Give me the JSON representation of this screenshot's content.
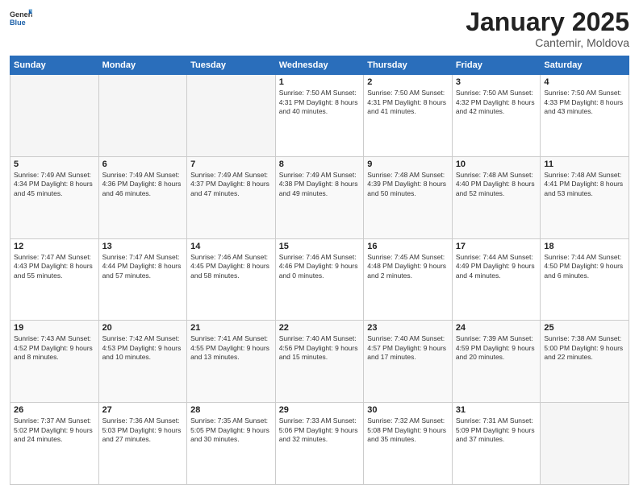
{
  "logo": {
    "text_general": "General",
    "text_blue": "Blue"
  },
  "header": {
    "title": "January 2025",
    "subtitle": "Cantemir, Moldova"
  },
  "days_of_week": [
    "Sunday",
    "Monday",
    "Tuesday",
    "Wednesday",
    "Thursday",
    "Friday",
    "Saturday"
  ],
  "weeks": [
    [
      {
        "day": "",
        "info": ""
      },
      {
        "day": "",
        "info": ""
      },
      {
        "day": "",
        "info": ""
      },
      {
        "day": "1",
        "info": "Sunrise: 7:50 AM\nSunset: 4:31 PM\nDaylight: 8 hours\nand 40 minutes."
      },
      {
        "day": "2",
        "info": "Sunrise: 7:50 AM\nSunset: 4:31 PM\nDaylight: 8 hours\nand 41 minutes."
      },
      {
        "day": "3",
        "info": "Sunrise: 7:50 AM\nSunset: 4:32 PM\nDaylight: 8 hours\nand 42 minutes."
      },
      {
        "day": "4",
        "info": "Sunrise: 7:50 AM\nSunset: 4:33 PM\nDaylight: 8 hours\nand 43 minutes."
      }
    ],
    [
      {
        "day": "5",
        "info": "Sunrise: 7:49 AM\nSunset: 4:34 PM\nDaylight: 8 hours\nand 45 minutes."
      },
      {
        "day": "6",
        "info": "Sunrise: 7:49 AM\nSunset: 4:36 PM\nDaylight: 8 hours\nand 46 minutes."
      },
      {
        "day": "7",
        "info": "Sunrise: 7:49 AM\nSunset: 4:37 PM\nDaylight: 8 hours\nand 47 minutes."
      },
      {
        "day": "8",
        "info": "Sunrise: 7:49 AM\nSunset: 4:38 PM\nDaylight: 8 hours\nand 49 minutes."
      },
      {
        "day": "9",
        "info": "Sunrise: 7:48 AM\nSunset: 4:39 PM\nDaylight: 8 hours\nand 50 minutes."
      },
      {
        "day": "10",
        "info": "Sunrise: 7:48 AM\nSunset: 4:40 PM\nDaylight: 8 hours\nand 52 minutes."
      },
      {
        "day": "11",
        "info": "Sunrise: 7:48 AM\nSunset: 4:41 PM\nDaylight: 8 hours\nand 53 minutes."
      }
    ],
    [
      {
        "day": "12",
        "info": "Sunrise: 7:47 AM\nSunset: 4:43 PM\nDaylight: 8 hours\nand 55 minutes."
      },
      {
        "day": "13",
        "info": "Sunrise: 7:47 AM\nSunset: 4:44 PM\nDaylight: 8 hours\nand 57 minutes."
      },
      {
        "day": "14",
        "info": "Sunrise: 7:46 AM\nSunset: 4:45 PM\nDaylight: 8 hours\nand 58 minutes."
      },
      {
        "day": "15",
        "info": "Sunrise: 7:46 AM\nSunset: 4:46 PM\nDaylight: 9 hours\nand 0 minutes."
      },
      {
        "day": "16",
        "info": "Sunrise: 7:45 AM\nSunset: 4:48 PM\nDaylight: 9 hours\nand 2 minutes."
      },
      {
        "day": "17",
        "info": "Sunrise: 7:44 AM\nSunset: 4:49 PM\nDaylight: 9 hours\nand 4 minutes."
      },
      {
        "day": "18",
        "info": "Sunrise: 7:44 AM\nSunset: 4:50 PM\nDaylight: 9 hours\nand 6 minutes."
      }
    ],
    [
      {
        "day": "19",
        "info": "Sunrise: 7:43 AM\nSunset: 4:52 PM\nDaylight: 9 hours\nand 8 minutes."
      },
      {
        "day": "20",
        "info": "Sunrise: 7:42 AM\nSunset: 4:53 PM\nDaylight: 9 hours\nand 10 minutes."
      },
      {
        "day": "21",
        "info": "Sunrise: 7:41 AM\nSunset: 4:55 PM\nDaylight: 9 hours\nand 13 minutes."
      },
      {
        "day": "22",
        "info": "Sunrise: 7:40 AM\nSunset: 4:56 PM\nDaylight: 9 hours\nand 15 minutes."
      },
      {
        "day": "23",
        "info": "Sunrise: 7:40 AM\nSunset: 4:57 PM\nDaylight: 9 hours\nand 17 minutes."
      },
      {
        "day": "24",
        "info": "Sunrise: 7:39 AM\nSunset: 4:59 PM\nDaylight: 9 hours\nand 20 minutes."
      },
      {
        "day": "25",
        "info": "Sunrise: 7:38 AM\nSunset: 5:00 PM\nDaylight: 9 hours\nand 22 minutes."
      }
    ],
    [
      {
        "day": "26",
        "info": "Sunrise: 7:37 AM\nSunset: 5:02 PM\nDaylight: 9 hours\nand 24 minutes."
      },
      {
        "day": "27",
        "info": "Sunrise: 7:36 AM\nSunset: 5:03 PM\nDaylight: 9 hours\nand 27 minutes."
      },
      {
        "day": "28",
        "info": "Sunrise: 7:35 AM\nSunset: 5:05 PM\nDaylight: 9 hours\nand 30 minutes."
      },
      {
        "day": "29",
        "info": "Sunrise: 7:33 AM\nSunset: 5:06 PM\nDaylight: 9 hours\nand 32 minutes."
      },
      {
        "day": "30",
        "info": "Sunrise: 7:32 AM\nSunset: 5:08 PM\nDaylight: 9 hours\nand 35 minutes."
      },
      {
        "day": "31",
        "info": "Sunrise: 7:31 AM\nSunset: 5:09 PM\nDaylight: 9 hours\nand 37 minutes."
      },
      {
        "day": "",
        "info": ""
      }
    ]
  ]
}
